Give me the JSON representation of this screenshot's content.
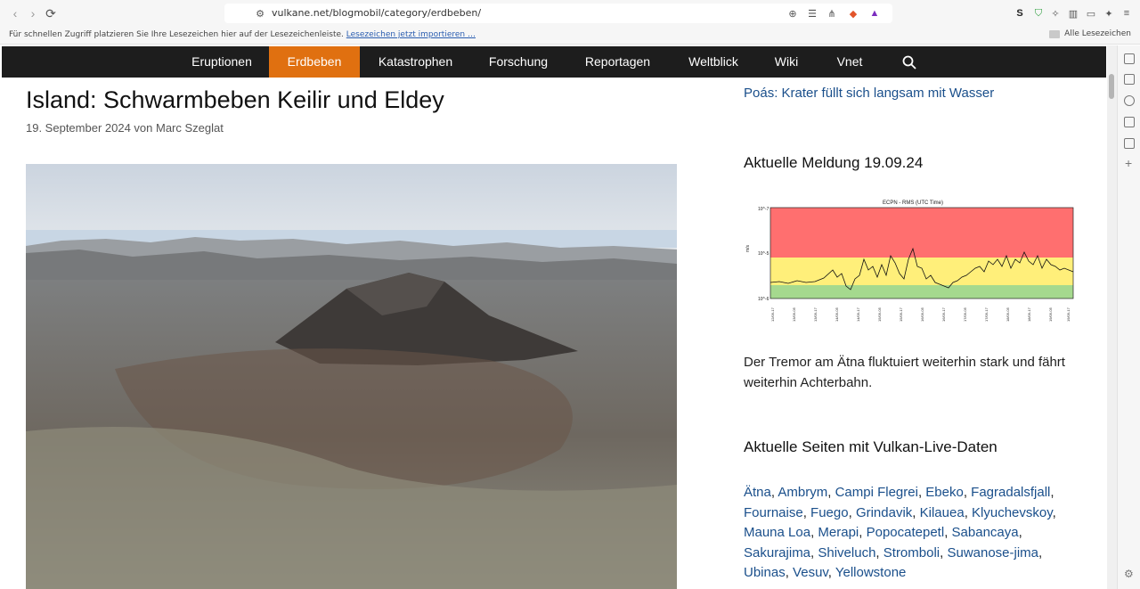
{
  "browser": {
    "url": "vulkane.net/blogmobil/category/erdbeben/",
    "bookmark_bar_text": "Für schnellen Zugriff platzieren Sie Ihre Lesezeichen hier auf der Lesezeichenleiste.",
    "bookmark_import_link": "Lesezeichen jetzt importieren …",
    "all_bookmarks": "Alle Lesezeichen"
  },
  "nav": {
    "items": [
      "Eruptionen",
      "Erdbeben",
      "Katastrophen",
      "Forschung",
      "Reportagen",
      "Weltblick",
      "Wiki",
      "Vnet"
    ],
    "active": "Erdbeben",
    "accent": "#e07010"
  },
  "article": {
    "title": "Island: Schwarmbeben Keilir und Eldey",
    "meta": "19. September 2024 von Marc Szeglat"
  },
  "sidebar": {
    "top_link": "Poás: Krater füllt sich langsam mit Wasser",
    "news_heading": "Aktuelle Meldung 19.09.24",
    "news_text": "Der Tremor am Ätna fluktuiert weiterhin stark und fährt weiterhin Achterbahn.",
    "live_heading": "Aktuelle Seiten mit Vulkan-Live-Daten",
    "live_links": [
      "Ätna",
      "Ambrym",
      "Campi Flegrei",
      "Ebeko",
      "Fagradalsfjall",
      "Fournaise",
      "Fuego",
      "Grindavik",
      "Kilauea",
      "Klyuchevskoy",
      "Mauna Loa",
      "Merapi",
      "Popocatepetl",
      "Sabancaya",
      "Sakurajima",
      "Shiveluch",
      "Stromboli",
      "Suwanose-jima",
      "Ubinas",
      "Vesuv",
      "Yellowstone"
    ]
  },
  "tremor_chart": {
    "title": "ECPN - RMS (UTC Time)",
    "ylabel": "m/s",
    "yticks": [
      "10^-5",
      "10^-6",
      "10^-7"
    ]
  }
}
